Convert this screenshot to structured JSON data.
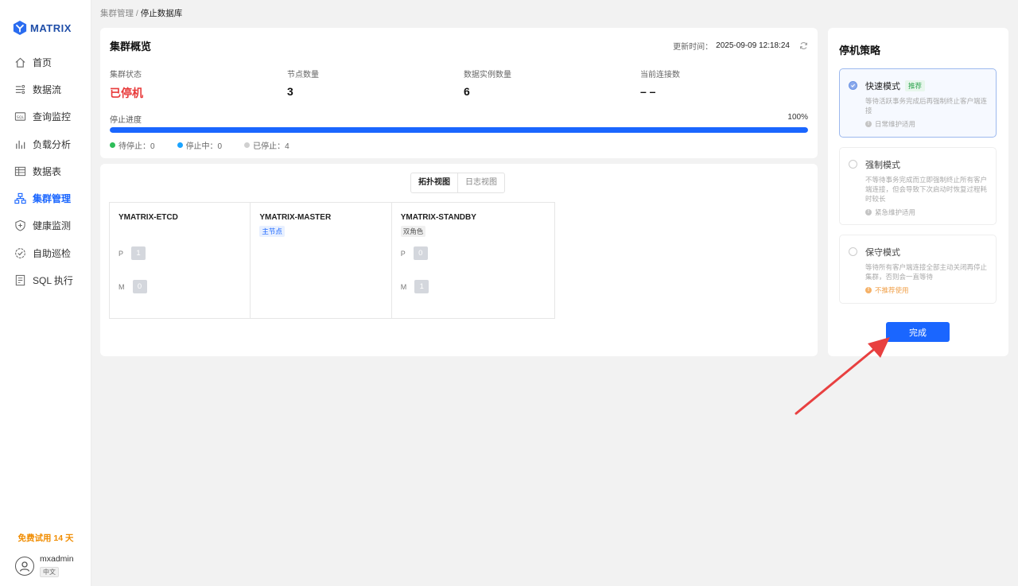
{
  "app": {
    "logo_text": "MATRIX",
    "trial_text": "免费试用 14 天",
    "user_name": "mxadmin",
    "language": "中文"
  },
  "sidebar": {
    "items": [
      {
        "label": "首页",
        "icon": "home-icon"
      },
      {
        "label": "数据流",
        "icon": "flow-icon"
      },
      {
        "label": "查询监控",
        "icon": "sql-monitor-icon"
      },
      {
        "label": "负载分析",
        "icon": "bar-chart-icon"
      },
      {
        "label": "数据表",
        "icon": "table-icon"
      },
      {
        "label": "集群管理",
        "icon": "cluster-icon",
        "active": true
      },
      {
        "label": "健康监测",
        "icon": "shield-plus-icon"
      },
      {
        "label": "自助巡检",
        "icon": "check-badge-icon"
      },
      {
        "label": "SQL 执行",
        "icon": "sql-file-icon"
      }
    ]
  },
  "breadcrumb": {
    "parent": "集群管理",
    "separator": " / ",
    "current": "停止数据库"
  },
  "overview": {
    "title": "集群概览",
    "update_label": "更新时间：",
    "update_time": "2025-09-09 12:18:24",
    "stats": [
      {
        "label": "集群状态",
        "value": "已停机"
      },
      {
        "label": "节点数量",
        "value": "3"
      },
      {
        "label": "数据实例数量",
        "value": "6"
      },
      {
        "label": "当前连接数",
        "value": "– –"
      }
    ],
    "progress": {
      "label": "停止进度",
      "percent_text": "100%",
      "percent": 100
    },
    "legend": [
      {
        "label": "待停止：0",
        "color": "#2ebd59"
      },
      {
        "label": "停止中：0",
        "color": "#1aa3ff"
      },
      {
        "label": "已停止：4",
        "color": "#d0d0d0"
      }
    ]
  },
  "topology": {
    "tabs": [
      "拓扑视图",
      "日志视图"
    ],
    "nodes": [
      {
        "name": "YMATRIX-ETCD",
        "tag": "",
        "p_label": "P",
        "p_value": "1",
        "m_label": "M",
        "m_value": "0"
      },
      {
        "name": "YMATRIX-MASTER",
        "tag": "主节点"
      },
      {
        "name": "YMATRIX-STANDBY",
        "tag": "双角色",
        "p_label": "P",
        "p_value": "0",
        "m_label": "M",
        "m_value": "1"
      }
    ]
  },
  "strategy": {
    "title": "停机策略",
    "options": [
      {
        "title": "快速模式",
        "badge": "推荐",
        "desc": "等待活跃事务完成后再强制终止客户端连接",
        "note": "日常维护适用"
      },
      {
        "title": "强制模式",
        "desc": "不等待事务完成而立即强制终止所有客户端连接，但会导致下次启动时恢复过程耗时较长",
        "note": "紧急维护适用"
      },
      {
        "title": "保守模式",
        "desc": "等待所有客户端连接全部主动关闭再停止集群，否则会一直等待",
        "note": "不推荐使用"
      }
    ],
    "done_label": "完成"
  },
  "colors": {
    "primary": "#1a66ff",
    "danger": "#e83a3a",
    "trial": "#f08c00",
    "annotation_arrow": "#e84040"
  }
}
